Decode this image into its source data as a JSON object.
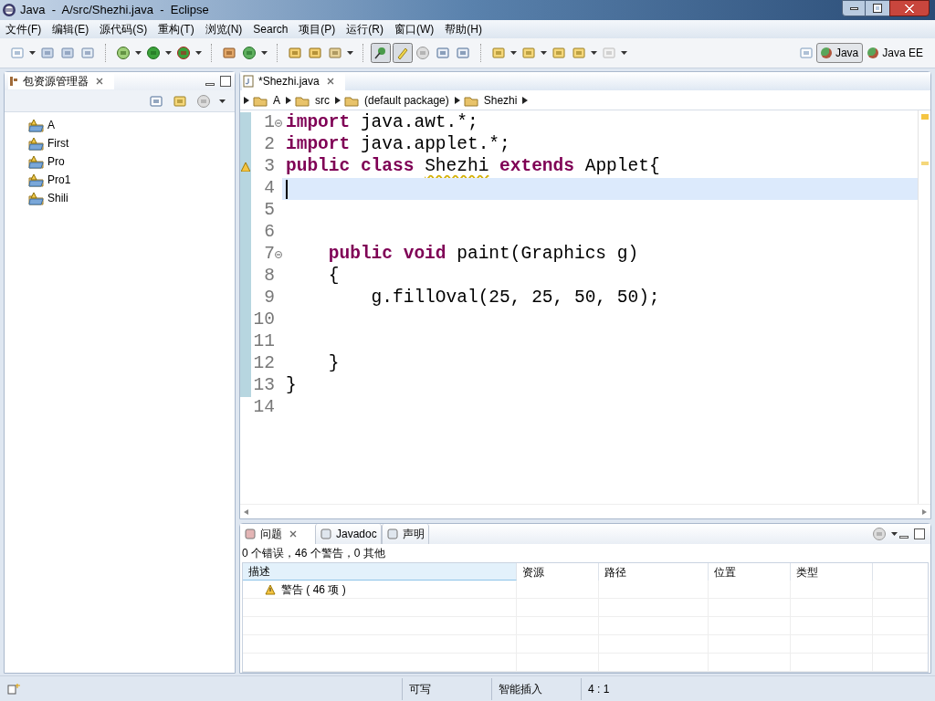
{
  "window": {
    "title": "Java  -  A/src/Shezhi.java  -  Eclipse"
  },
  "menu": [
    "文件(F)",
    "编辑(E)",
    "源代码(S)",
    "重构(T)",
    "浏览(N)",
    "Search",
    "项目(P)",
    "运行(R)",
    "窗口(W)",
    "帮助(H)"
  ],
  "perspectives": [
    {
      "label": "Java",
      "selected": true
    },
    {
      "label": "Java EE",
      "selected": false
    }
  ],
  "package_explorer": {
    "title": "包资源管理器",
    "projects": [
      "A",
      "First",
      "Pro",
      "Pro1",
      "Shili"
    ]
  },
  "editor": {
    "tab": "*Shezhi.java",
    "breadcrumb": [
      "A",
      "src",
      "(default package)",
      "Shezhi"
    ],
    "lines": [
      {
        "number": "1",
        "current": false,
        "fold": true,
        "warning": false,
        "tokens": [
          {
            "kind": "keyword",
            "text": "import"
          },
          {
            "kind": "plain",
            "text": "java.awt.*;"
          }
        ]
      },
      {
        "number": "2",
        "current": false,
        "fold": false,
        "warning": false,
        "tokens": [
          {
            "kind": "keyword",
            "text": "import"
          },
          {
            "kind": "plain",
            "text": "java.applet.*;"
          }
        ]
      },
      {
        "number": "3",
        "current": false,
        "fold": false,
        "warning": true,
        "tokens": [
          {
            "kind": "keyword",
            "text": "public class"
          },
          {
            "kind": "warned",
            "text": "Shezhi"
          },
          {
            "kind": "keyword",
            "text": "extends"
          },
          {
            "kind": "plain",
            "text": "Applet{"
          }
        ]
      },
      {
        "number": "4",
        "current": true,
        "fold": false,
        "warning": false
      },
      {
        "number": "5",
        "current": false,
        "fold": false,
        "warning": false
      },
      {
        "number": "6",
        "current": false,
        "fold": false,
        "warning": false
      },
      {
        "number": "7",
        "current": false,
        "fold": true,
        "warning": false,
        "tokens": [
          {
            "kind": "keyword",
            "text": "    public void"
          },
          {
            "kind": "plain",
            "text": "paint(Graphics g)"
          }
        ]
      },
      {
        "number": "8",
        "current": false,
        "fold": false,
        "warning": false,
        "tokens": [
          {
            "kind": "plain",
            "text": "    {"
          }
        ]
      },
      {
        "number": "9",
        "current": false,
        "fold": false,
        "warning": false,
        "tokens": [
          {
            "kind": "plain",
            "text": "        g.fillOval(25, 25, 50, 50);"
          }
        ]
      },
      {
        "number": "10",
        "current": false,
        "fold": false,
        "warning": false
      },
      {
        "number": "11",
        "current": false,
        "fold": false,
        "warning": false
      },
      {
        "number": "12",
        "current": false,
        "fold": false,
        "warning": false,
        "tokens": [
          {
            "kind": "plain",
            "text": "    }"
          }
        ]
      },
      {
        "number": "13",
        "current": false,
        "fold": false,
        "warning": false,
        "tokens": [
          {
            "kind": "plain",
            "text": "}"
          }
        ]
      },
      {
        "number": "14",
        "current": false,
        "fold": false,
        "warning": false
      }
    ]
  },
  "problems": {
    "tabs": [
      {
        "label": "问题",
        "selected": true
      },
      {
        "label": "Javadoc",
        "selected": false
      },
      {
        "label": "声明",
        "selected": false
      }
    ],
    "summary": "0 个错误，46 个警告，0 其他",
    "columns": [
      "描述",
      "资源",
      "路径",
      "位置",
      "类型"
    ],
    "rows": [
      {
        "description": "警告 ( 46 项 )"
      }
    ]
  },
  "status_bar": [
    "可写",
    "智能插入",
    "4 : 1"
  ]
}
